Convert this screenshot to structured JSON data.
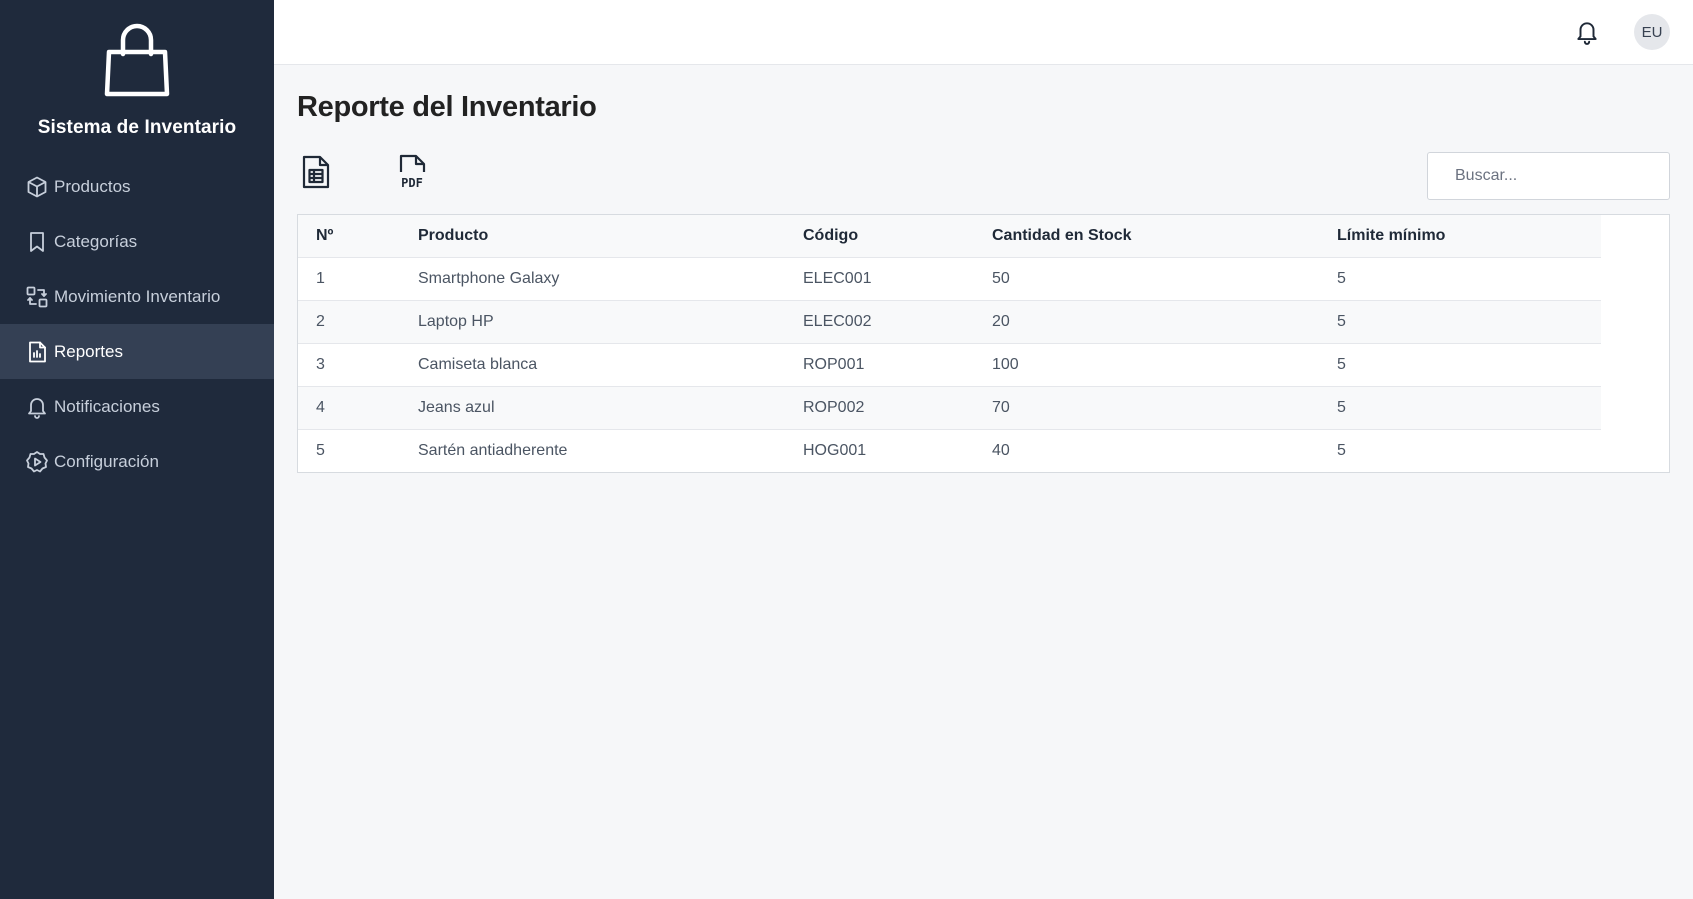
{
  "app": {
    "title": "Sistema de Inventario",
    "logo_icon": "shopping-bag-icon"
  },
  "sidebar": {
    "items": [
      {
        "label": "Productos",
        "icon": "box-icon",
        "active": false
      },
      {
        "label": "Categorías",
        "icon": "bookmark-icon",
        "active": false
      },
      {
        "label": "Movimiento Inventario",
        "icon": "swap-icon",
        "active": false
      },
      {
        "label": "Reportes",
        "icon": "report-icon",
        "active": true
      },
      {
        "label": "Notificaciones",
        "icon": "bell-icon",
        "active": false
      },
      {
        "label": "Configuración",
        "icon": "gear-icon",
        "active": false
      }
    ]
  },
  "topbar": {
    "avatar_initials": "EU"
  },
  "page": {
    "title": "Reporte del Inventario",
    "export_excel_icon": "spreadsheet-icon",
    "export_pdf_icon": "pdf-icon",
    "search_placeholder": "Buscar..."
  },
  "table": {
    "headers": [
      "Nº",
      "Producto",
      "Código",
      "Cantidad en Stock",
      "Límite mínimo"
    ],
    "rows": [
      [
        "1",
        "Smartphone Galaxy",
        "ELEC001",
        "50",
        "5"
      ],
      [
        "2",
        "Laptop HP",
        "ELEC002",
        "20",
        "5"
      ],
      [
        "3",
        "Camiseta blanca",
        "ROP001",
        "100",
        "5"
      ],
      [
        "4",
        "Jeans azul",
        "ROP002",
        "70",
        "5"
      ],
      [
        "5",
        "Sartén antiadherente",
        "HOG001",
        "40",
        "5"
      ]
    ]
  },
  "colors": {
    "sidebar_bg": "#1f2a3c",
    "sidebar_active_bg": "#344054",
    "page_bg": "#f6f7f9"
  }
}
